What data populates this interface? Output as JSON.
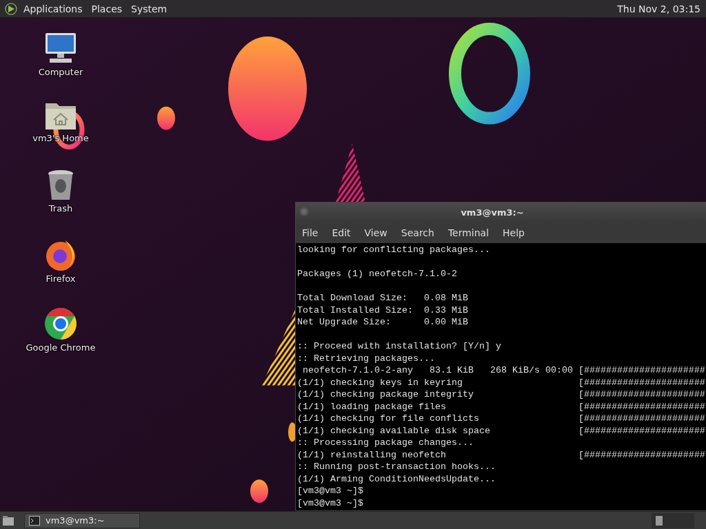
{
  "top_panel": {
    "menus": [
      "Applications",
      "Places",
      "System"
    ],
    "clock": "Thu Nov 2, 03:15"
  },
  "desktop_icons": [
    {
      "label": "Computer",
      "kind": "computer"
    },
    {
      "label": "vm3's Home",
      "kind": "home"
    },
    {
      "label": "Trash",
      "kind": "trash"
    },
    {
      "label": "Firefox",
      "kind": "firefox"
    },
    {
      "label": "Google Chrome",
      "kind": "chrome"
    }
  ],
  "terminal": {
    "title": "vm3@vm3:~",
    "menu": [
      "File",
      "Edit",
      "View",
      "Search",
      "Terminal",
      "Help"
    ],
    "output_blocks": [
      [
        "looking for conflicting packages..."
      ],
      [
        "Packages (1) neofetch-7.1.0-2"
      ],
      [
        "Total Download Size:   0.08 MiB",
        "Total Installed Size:  0.33 MiB",
        "Net Upgrade Size:      0.00 MiB"
      ],
      [
        ":: Proceed with installation? [Y/n] y",
        ":: Retrieving packages...",
        " neofetch-7.1.0-2-any   83.1 KiB   268 KiB/s 00:00 [######################",
        "(1/1) checking keys in keyring                     [######################",
        "(1/1) checking package integrity                   [######################",
        "(1/1) loading package files                        [######################",
        "(1/1) checking for file conflicts                  [######################",
        "(1/1) checking available disk space                [######################",
        ":: Processing package changes...",
        "(1/1) reinstalling neofetch                        [######################",
        ":: Running post-transaction hooks...",
        "(1/1) Arming ConditionNeedsUpdate...",
        "[vm3@vm3 ~]$",
        "[vm3@vm3 ~]$"
      ]
    ]
  },
  "taskbar": {
    "tasks": [
      "vm3@vm3:~"
    ]
  }
}
